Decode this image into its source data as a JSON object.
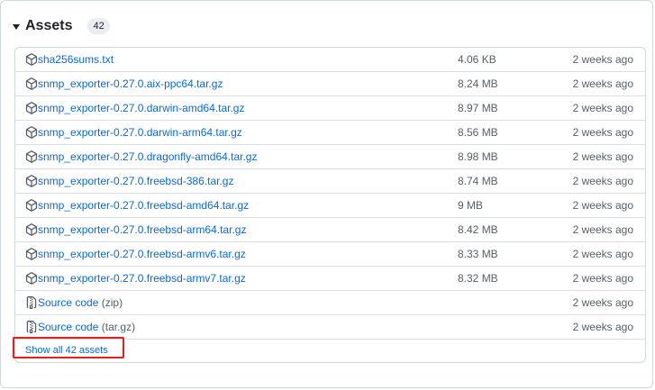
{
  "assets": {
    "title": "Assets",
    "count": "42",
    "show_all_label": "Show all 42 assets",
    "highlight_color": "#e5201c",
    "link_color": "#0969da",
    "items": [
      {
        "name": "sha256sums.txt",
        "icon": "package-icon",
        "size": "4.06 KB",
        "time": "2 weeks ago"
      },
      {
        "name": "snmp_exporter-0.27.0.aix-ppc64.tar.gz",
        "icon": "package-icon",
        "size": "8.24 MB",
        "time": "2 weeks ago"
      },
      {
        "name": "snmp_exporter-0.27.0.darwin-amd64.tar.gz",
        "icon": "package-icon",
        "size": "8.97 MB",
        "time": "2 weeks ago"
      },
      {
        "name": "snmp_exporter-0.27.0.darwin-arm64.tar.gz",
        "icon": "package-icon",
        "size": "8.56 MB",
        "time": "2 weeks ago"
      },
      {
        "name": "snmp_exporter-0.27.0.dragonfly-amd64.tar.gz",
        "icon": "package-icon",
        "size": "8.98 MB",
        "time": "2 weeks ago"
      },
      {
        "name": "snmp_exporter-0.27.0.freebsd-386.tar.gz",
        "icon": "package-icon",
        "size": "8.74 MB",
        "time": "2 weeks ago"
      },
      {
        "name": "snmp_exporter-0.27.0.freebsd-amd64.tar.gz",
        "icon": "package-icon",
        "size": "9 MB",
        "time": "2 weeks ago"
      },
      {
        "name": "snmp_exporter-0.27.0.freebsd-arm64.tar.gz",
        "icon": "package-icon",
        "size": "8.42 MB",
        "time": "2 weeks ago"
      },
      {
        "name": "snmp_exporter-0.27.0.freebsd-armv6.tar.gz",
        "icon": "package-icon",
        "size": "8.33 MB",
        "time": "2 weeks ago"
      },
      {
        "name": "snmp_exporter-0.27.0.freebsd-armv7.tar.gz",
        "icon": "package-icon",
        "size": "8.32 MB",
        "time": "2 weeks ago"
      }
    ],
    "source_items": [
      {
        "name": "Source code",
        "suffix": "(zip)",
        "icon": "file-zip-icon",
        "time": "2 weeks ago"
      },
      {
        "name": "Source code",
        "suffix": "(tar.gz)",
        "icon": "file-zip-icon",
        "time": "2 weeks ago"
      }
    ]
  }
}
